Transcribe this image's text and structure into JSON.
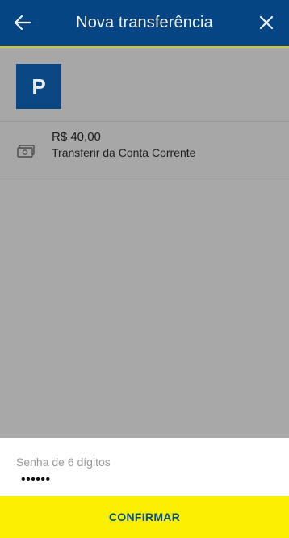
{
  "header": {
    "title": "Nova transferência",
    "back_icon": "arrow-left-icon",
    "close_icon": "close-icon",
    "background_color": "#054584",
    "accent_line_color": "#c9c24a"
  },
  "recipient": {
    "avatar_letter": "P",
    "avatar_color": "#0b4782"
  },
  "transfer": {
    "amount": "R$ 40,00",
    "source": "Transferir da Conta Corrente",
    "icon": "money-icon"
  },
  "password": {
    "label": "Senha de 6 dígitos",
    "value": "••••••"
  },
  "confirm_button": {
    "label": "CONFIRMAR",
    "background_color": "#fcf000",
    "text_color": "#0a4d86"
  }
}
